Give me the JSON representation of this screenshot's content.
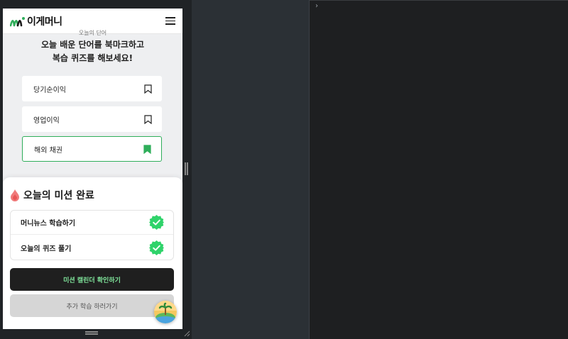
{
  "app": {
    "brand_name": "이게머니",
    "brand_color": "#2fae5a"
  },
  "quiz_intro": {
    "section_label": "오늘의 단어",
    "headline_line1": "오늘 배운 단어를 북마크하고",
    "headline_line2": "복습 퀴즈를 해보세요!"
  },
  "words": [
    {
      "label": "당기순이익",
      "bookmarked": false,
      "icon": "bookmark-outline-icon"
    },
    {
      "label": "영업이익",
      "bookmarked": false,
      "icon": "bookmark-outline-icon"
    },
    {
      "label": "해외 채권",
      "bookmarked": true,
      "icon": "bookmark-filled-icon"
    }
  ],
  "mission_sheet": {
    "title": "오늘의 미션 완료",
    "items": [
      {
        "label": "머니뉴스 학습하기",
        "done": true
      },
      {
        "label": "오늘의 퀴즈 풀기",
        "done": true
      }
    ],
    "primary_button": "미션 캘린더 확인하기",
    "secondary_button": "추가 학습 하러가기"
  },
  "console": {
    "prompt": "›"
  }
}
